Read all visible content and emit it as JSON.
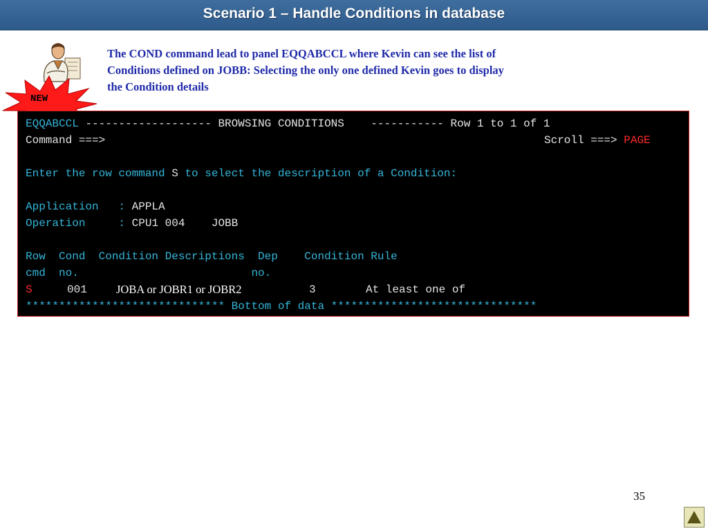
{
  "slide": {
    "title": "Scenario 1 – Handle Conditions in database",
    "new_badge": "NEW",
    "description_lines": [
      "The COND command lead to panel EQQABCCL where Kevin can see the list of",
      "Conditions defined on JOBB: Selecting the only one defined  Kevin goes to display",
      "the Condition details"
    ],
    "page_number": "35",
    "nav_icon": "triangle-up-icon"
  },
  "terminal": {
    "panel_id": "EQQABCCL",
    "header_mid": " ------------------- BROWSING CONDITIONS    ----------- Row 1 to 1 of 1",
    "command_label": "Command ===>",
    "scroll_label": "Scroll ===>",
    "scroll_value": "PAGE",
    "instruction_a": "Enter the row command ",
    "instruction_s": "S",
    "instruction_b": " to select the description of a Condition:",
    "application_label": "Application   : ",
    "application_value": "APPLA",
    "operation_label": "Operation     : ",
    "operation_value": "CPU1 004    JOBB",
    "columns_line1": "Row  Cond  Condition Descriptions  Dep    Condition Rule",
    "columns_line2": "cmd  no.                          no.",
    "row": {
      "cmd": "S",
      "cond_no": "001",
      "description": "JOBA or JOBR1 or JOBR2",
      "dep_no": "3",
      "rule": "At least one of"
    },
    "bottom_stars_left": "******************************",
    "bottom_text": " Bottom of data ",
    "bottom_stars_right": "*******************************"
  },
  "colors": {
    "title_bar": "#2d5a8a",
    "terminal_bg": "#000000",
    "terminal_cyan": "#35b5d8",
    "terminal_red": "#ff2a2a",
    "description_text": "#1f2aa8"
  }
}
